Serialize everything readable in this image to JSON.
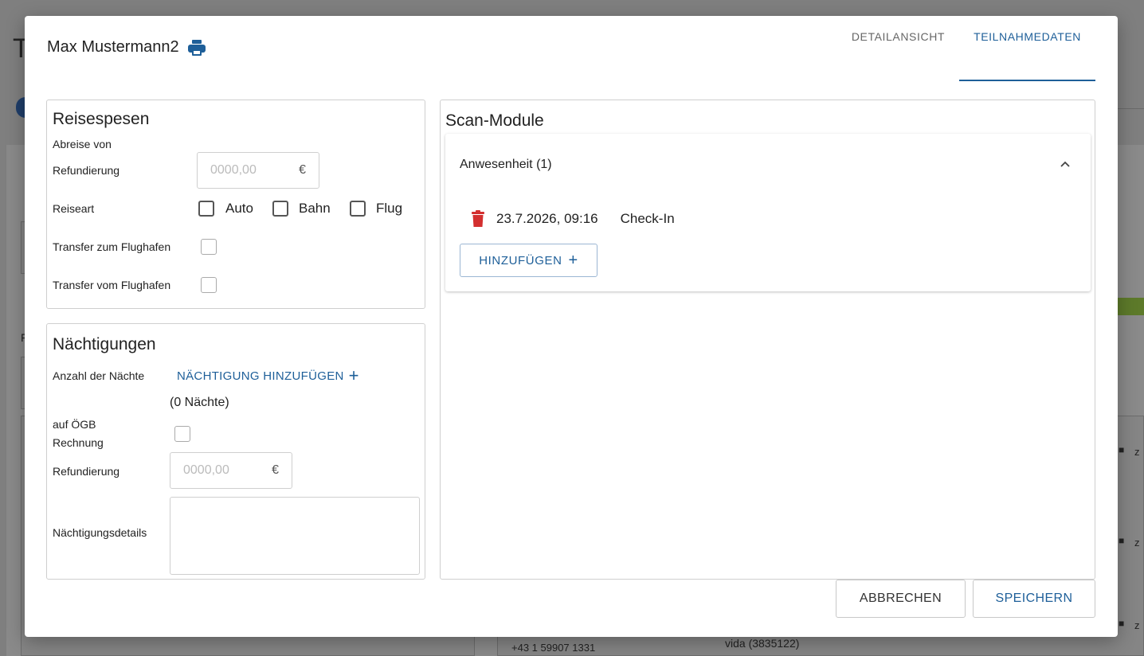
{
  "background": {
    "letter": "T",
    "side_letter": "F",
    "phone": "+43 1 59907 1331",
    "vida": "vida (3835122)",
    "z": "z"
  },
  "modal": {
    "title": "Max Mustermann2",
    "tabs": [
      {
        "label": "DETAILANSICHT",
        "active": false
      },
      {
        "label": "TEILNAHMEDATEN",
        "active": true
      }
    ]
  },
  "reisespesen": {
    "title": "Reisespesen",
    "abreise_label": "Abreise von",
    "refund_label": "Refundierung",
    "refund_placeholder": "0000,00",
    "currency": "€",
    "reiseart_label": "Reiseart",
    "options": [
      "Auto",
      "Bahn",
      "Flug"
    ],
    "transfer_to": "Transfer zum Flughafen",
    "transfer_from": "Transfer vom Flughafen"
  },
  "naechtigungen": {
    "title": "Nächtigungen",
    "count_label": "Anzahl der Nächte",
    "add_label": "NÄCHTIGUNG HINZUFÜGEN",
    "count_value": "(0 Nächte)",
    "oegb_label_1": "auf ÖGB",
    "oegb_label_2": "Rechnung",
    "refund_label": "Refundierung",
    "refund_placeholder": "0000,00",
    "currency": "€",
    "details_label": "Nächtigungsdetails"
  },
  "scan": {
    "title": "Scan-Module",
    "section_title": "Anwesenheit (1)",
    "entries": [
      {
        "timestamp": "23.7.2026, 09:16",
        "type": "Check-In"
      }
    ],
    "add_label": "HINZUFÜGEN"
  },
  "footer": {
    "cancel": "ABBRECHEN",
    "save": "SPEICHERN"
  },
  "colors": {
    "accent": "#1e5f99",
    "danger": "#d32f2f"
  }
}
